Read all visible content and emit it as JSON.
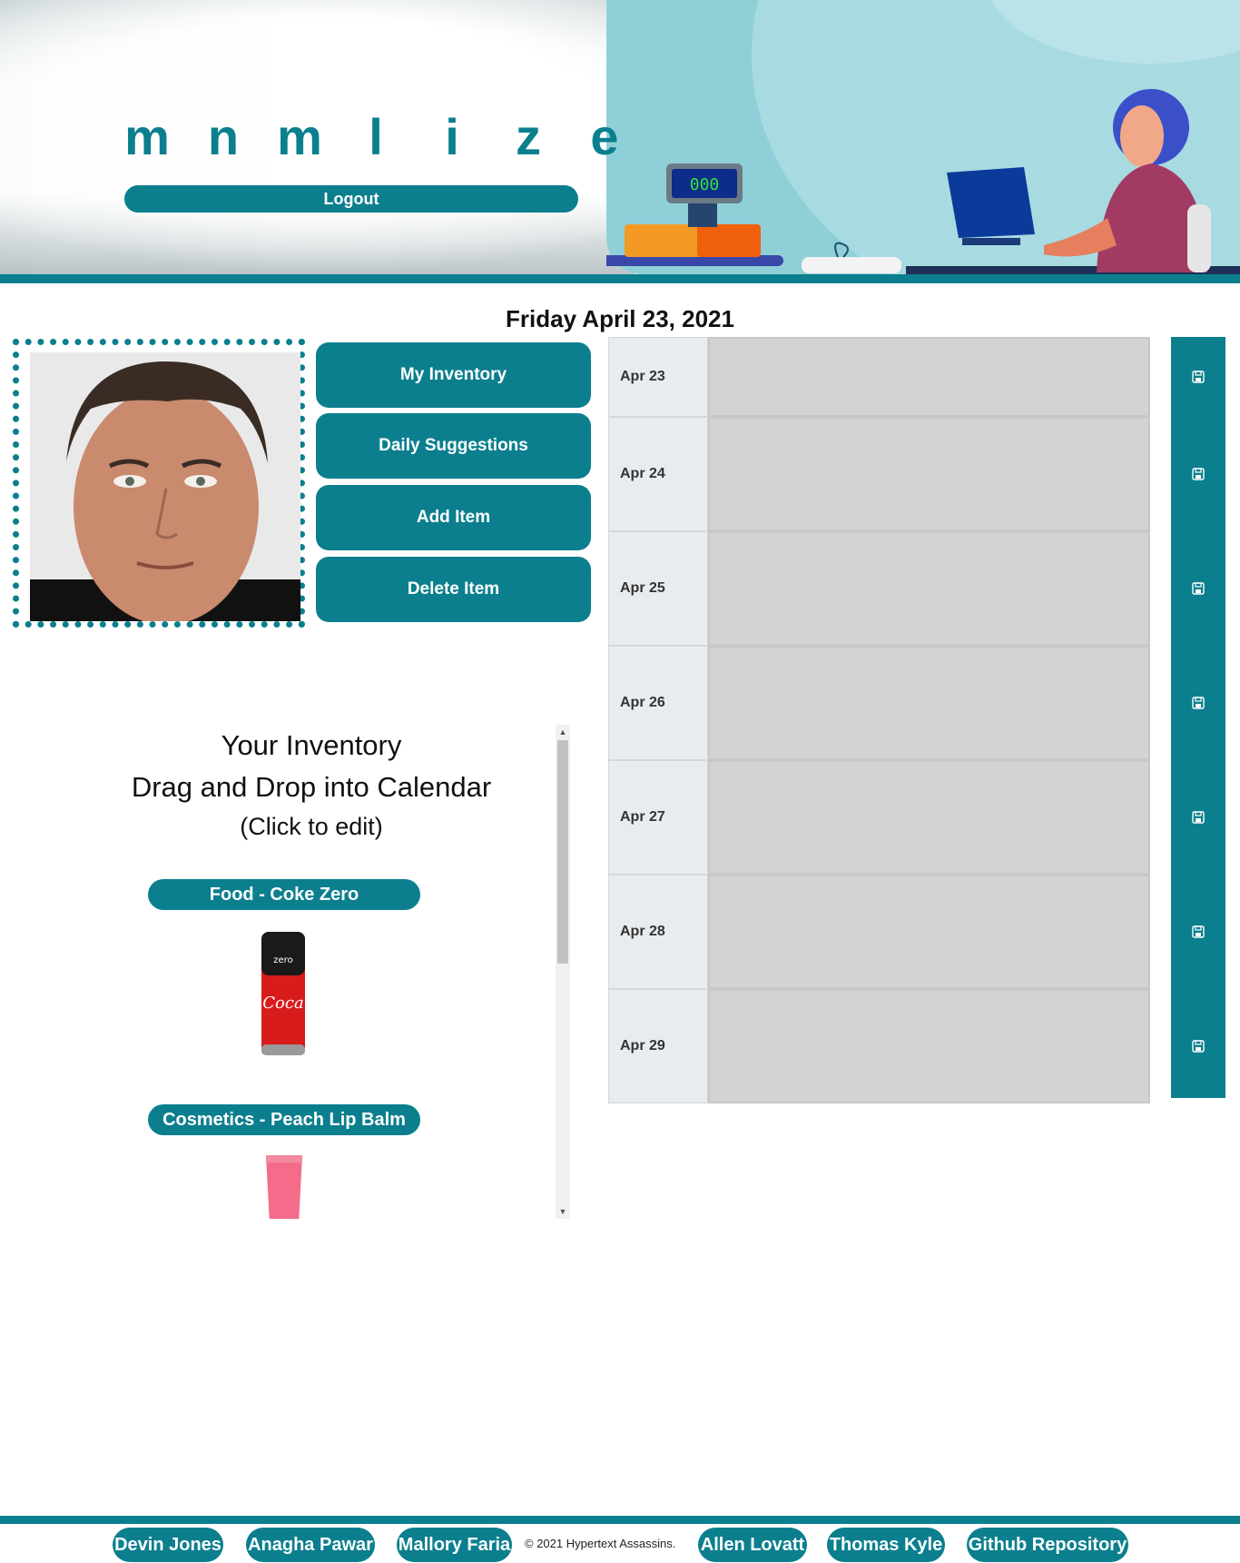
{
  "header": {
    "logo_letters": [
      "m",
      "n",
      "m",
      "l",
      "i",
      "z",
      "e"
    ],
    "logout_label": "Logout"
  },
  "date_title": "Friday April 23, 2021",
  "nav": {
    "my_inventory": "My Inventory",
    "daily_suggestions": "Daily Suggestions",
    "add_item": "Add Item",
    "delete_item": "Delete Item"
  },
  "inventory": {
    "title": "Your Inventory",
    "subtitle": "Drag and Drop into Calendar",
    "hint": "(Click to edit)",
    "items": [
      {
        "label": "Food - Coke Zero"
      },
      {
        "label": "Cosmetics - Peach Lip Balm"
      }
    ]
  },
  "calendar": {
    "days": [
      "Apr 23",
      "Apr 24",
      "Apr 25",
      "Apr 26",
      "Apr 27",
      "Apr 28",
      "Apr 29"
    ],
    "save_icon": "floppy-disk-icon"
  },
  "footer": {
    "links": [
      "Devin Jones",
      "Anagha Pawar",
      "Mallory Faria",
      "Allen Lovatt",
      "Thomas Kyle",
      "Github Repository"
    ],
    "copyright": "© 2021 Hypertext Assassins."
  },
  "colors": {
    "accent": "#0b7f8e",
    "calendar_slot": "#d3d3d3",
    "calendar_day": "#e9ecef"
  }
}
